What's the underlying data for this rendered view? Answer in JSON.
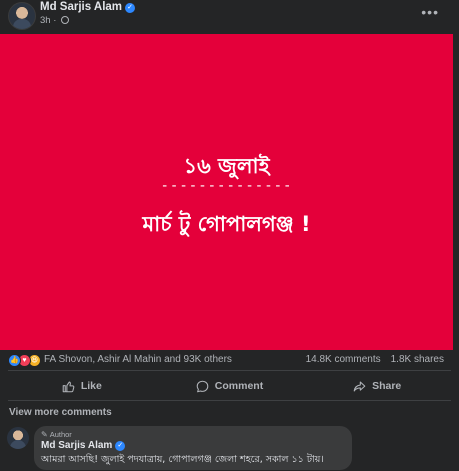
{
  "post": {
    "author": "Md Sarjis Alam",
    "time": "3h",
    "more_icon": "more-horizontal-icon"
  },
  "image": {
    "line1": "১৬ জুলাই",
    "dashes": "--------------",
    "line2": "মার্চ টু গোপালগঞ্জ !",
    "background_color": "#e4003a"
  },
  "reactions": {
    "icons": [
      "like-icon",
      "love-icon",
      "haha-icon"
    ],
    "reactors": "FA Shovon, Ashir Al Mahin and 93K others",
    "comments": "14.8K comments",
    "shares": "1.8K shares"
  },
  "actions": {
    "like": "Like",
    "comment": "Comment",
    "share": "Share"
  },
  "view_more_comments": "View more comments",
  "comment": {
    "badge": "Author",
    "author": "Md Sarjis Alam",
    "text": "আমরা আসছি! জুলাই পদযাত্রায়, গোপালগঞ্জ জেলা শহরে, সকাল ১১ টায়।"
  },
  "colors": {
    "background": "#242526",
    "accent": "#2d88ff",
    "image_red": "#e4003a"
  }
}
